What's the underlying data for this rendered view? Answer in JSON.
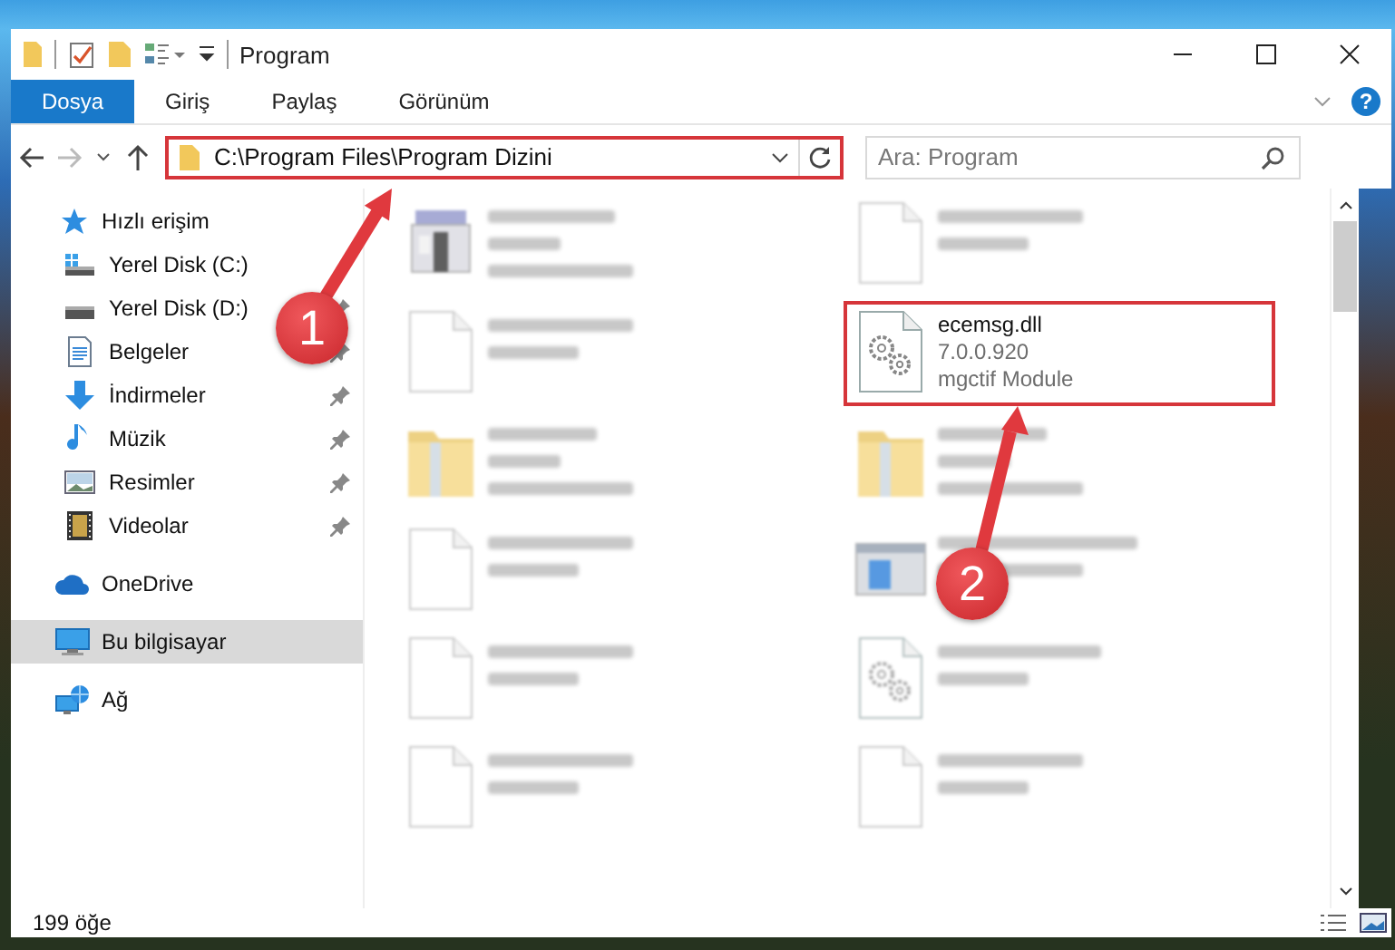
{
  "window": {
    "title": "Program"
  },
  "ribbon": {
    "tabs": [
      {
        "label": "Dosya",
        "selected": true
      },
      {
        "label": "Giriş",
        "selected": false
      },
      {
        "label": "Paylaş",
        "selected": false
      },
      {
        "label": "Görünüm",
        "selected": false
      }
    ],
    "help": "?"
  },
  "address_bar": {
    "path": "C:\\Program Files\\Program Dizini",
    "highlighted": true,
    "forward_disabled": true
  },
  "search": {
    "placeholder": "Ara: Program"
  },
  "sidebar": {
    "items": [
      {
        "label": "Hızlı erişim",
        "kind": "star",
        "selected": false,
        "children": [
          {
            "label": "Yerel Disk (C:)",
            "kind": "drive-c",
            "pinned": false,
            "selected": false
          },
          {
            "label": "Yerel Disk (D:)",
            "kind": "drive",
            "pinned": true,
            "selected": false
          },
          {
            "label": "Belgeler",
            "kind": "docs",
            "pinned": true,
            "selected": false
          },
          {
            "label": "İndirmeler",
            "kind": "download",
            "pinned": true,
            "selected": false
          },
          {
            "label": "Müzik",
            "kind": "music",
            "pinned": true,
            "selected": false
          },
          {
            "label": "Resimler",
            "kind": "pictures",
            "pinned": true,
            "selected": false
          },
          {
            "label": "Videolar",
            "kind": "videos",
            "pinned": true,
            "selected": false
          }
        ]
      },
      {
        "label": "OneDrive",
        "kind": "cloud",
        "selected": false
      },
      {
        "label": "Bu bilgisayar",
        "kind": "computer",
        "selected": true
      },
      {
        "label": "Ağ",
        "kind": "network",
        "selected": false
      }
    ]
  },
  "files": [
    {
      "kind": "exe",
      "blurred": true,
      "highlighted": false
    },
    {
      "kind": "file",
      "blurred": true,
      "highlighted": false
    },
    {
      "kind": "file",
      "blurred": true,
      "highlighted": false
    },
    {
      "name": "ecemsg.dll",
      "details": [
        "7.0.0.920",
        "mgctif Module"
      ],
      "kind": "dll",
      "blurred": false,
      "highlighted": true
    },
    {
      "kind": "folder",
      "blurred": true,
      "highlighted": false
    },
    {
      "kind": "folder",
      "blurred": true,
      "highlighted": false
    },
    {
      "kind": "file",
      "blurred": true,
      "highlighted": false
    },
    {
      "kind": "app",
      "blurred": true,
      "highlighted": false
    },
    {
      "kind": "file",
      "blurred": true,
      "highlighted": false
    },
    {
      "kind": "dll",
      "blurred": true,
      "highlighted": false
    },
    {
      "kind": "file",
      "blurred": true,
      "highlighted": false
    },
    {
      "kind": "file",
      "blurred": true,
      "highlighted": false
    }
  ],
  "status_bar": {
    "item_count": "199 öğe"
  },
  "annotations": [
    {
      "label": "1"
    },
    {
      "label": "2"
    }
  ]
}
